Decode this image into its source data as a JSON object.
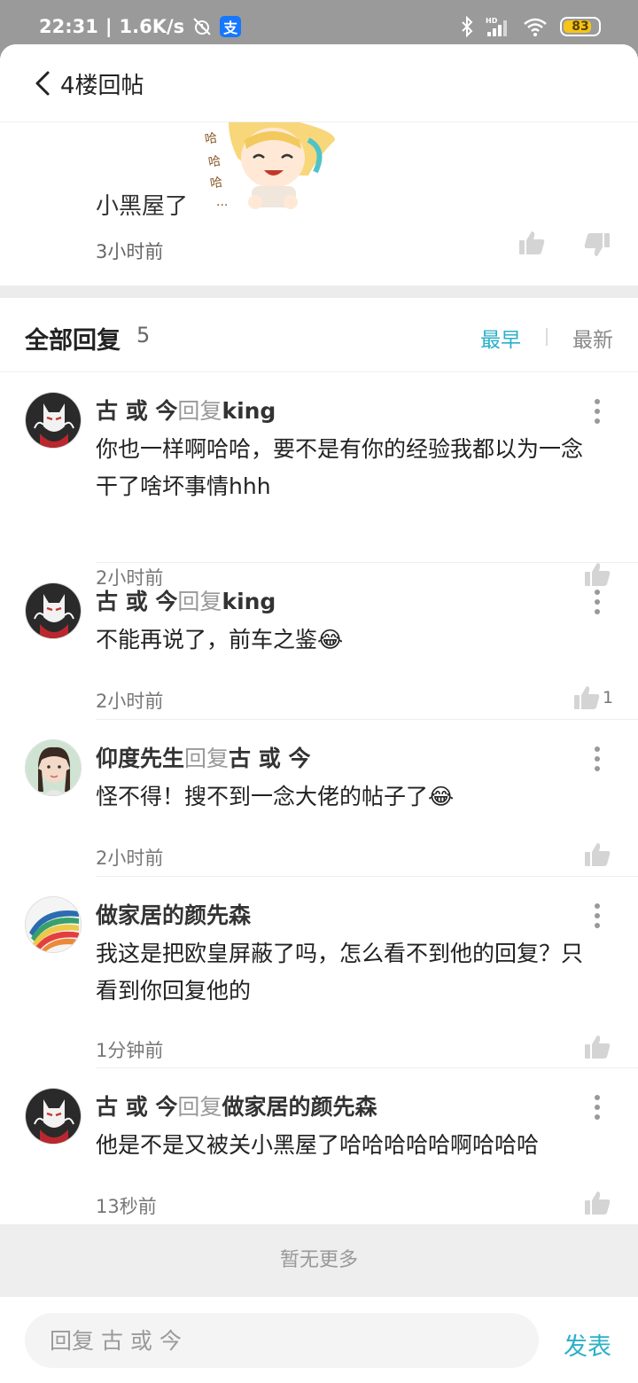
{
  "status_bar": {
    "time": "22:31",
    "speed": "1.6K/s",
    "alipay_label": "支",
    "network": "HD",
    "battery_percent": 83
  },
  "header": {
    "title": "4楼回帖"
  },
  "original_post": {
    "text": "小黑屋了",
    "time": "3小时前"
  },
  "replies_header": {
    "title": "全部回复",
    "count": "5",
    "sort_earliest": "最早",
    "sort_latest": "最新"
  },
  "replies": [
    {
      "author": "古 或 今",
      "reply_label": "回复",
      "reply_to": "king",
      "body": "你也一样啊哈哈，要不是有你的经验我都以为一念干了啥坏事情hhh",
      "time": "2小时前",
      "likes": "",
      "avatar": "mask-character"
    },
    {
      "author": "古 或 今",
      "reply_label": "回复",
      "reply_to": "king",
      "body": "不能再说了，前车之鉴😂",
      "time": "2小时前",
      "likes": "1",
      "avatar": "mask-character"
    },
    {
      "author": "仰度先生",
      "reply_label": "回复",
      "reply_to": "古 或 今",
      "body": "怪不得！搜不到一念大佬的帖子了😂",
      "time": "2小时前",
      "likes": "",
      "avatar": "girl-photo"
    },
    {
      "author": "做家居的颜先森",
      "reply_label": "",
      "reply_to": "",
      "body": "我这是把欧皇屏蔽了吗，怎么看不到他的回复？只看到你回复他的",
      "time": "1分钟前",
      "likes": "",
      "avatar": "color-swatches"
    },
    {
      "author": "古 或 今",
      "reply_label": "回复",
      "reply_to": "做家居的颜先森",
      "body": "他是不是又被关小黑屋了哈哈哈哈哈啊哈哈哈",
      "time": "13秒前",
      "likes": "",
      "avatar": "mask-character"
    }
  ],
  "no_more": "暂无更多",
  "reply_bar": {
    "placeholder": "回复 古 或 今",
    "send_label": "发表"
  },
  "colors": {
    "accent": "#2bb0c8",
    "status_bar_bg": "#9a9a9a",
    "battery": "#f5c518"
  }
}
